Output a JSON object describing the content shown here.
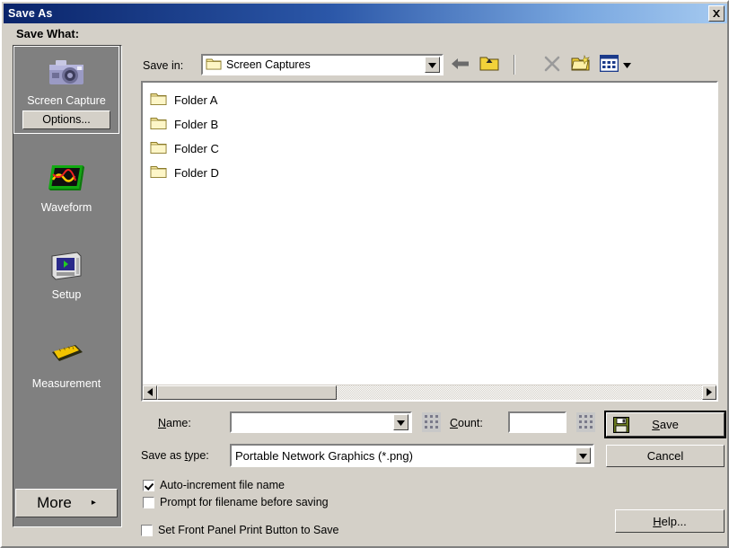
{
  "window": {
    "title": "Save As",
    "close_icon": "close-x-icon",
    "titlebar_color_left": "#0a246a",
    "titlebar_color_right": "#a6caf0",
    "face_color": "#d4d0c8"
  },
  "sidebar": {
    "heading": "Save What:",
    "items": [
      {
        "label": "Screen Capture",
        "icon": "camera-icon",
        "selected": true,
        "options_label": "Options..."
      },
      {
        "label": "Waveform",
        "icon": "waveform-screen-icon",
        "selected": false
      },
      {
        "label": "Setup",
        "icon": "instrument-setup-icon",
        "selected": false
      },
      {
        "label": "Measurement",
        "icon": "ruler-icon",
        "selected": false
      }
    ],
    "more_label": "More",
    "more_arrow": "▸"
  },
  "toolbar": {
    "save_in_label": "Save in:",
    "current_folder": "Screen Captures",
    "folder_icon": "folder-icon",
    "dropdown_icon": "chevron-down-icon",
    "back_label": "Back",
    "back_icon": "back-arrow-icon",
    "up_label": "Up One Level",
    "up_icon": "up-folder-icon",
    "delete_label": "Delete",
    "delete_icon": "delete-x-icon",
    "new_folder_label": "Create New Folder",
    "new_folder_icon": "new-folder-icon",
    "views_label": "Views",
    "views_icon": "views-grid-icon",
    "views_arrow_icon": "chevron-down-icon"
  },
  "file_list": {
    "items": [
      {
        "name": "Folder A",
        "icon": "folder-icon"
      },
      {
        "name": "Folder B",
        "icon": "folder-icon"
      },
      {
        "name": "Folder C",
        "icon": "folder-icon"
      },
      {
        "name": "Folder D",
        "icon": "folder-icon"
      }
    ],
    "scroll_left_icon": "triangle-left-icon",
    "scroll_right_icon": "triangle-right-icon"
  },
  "form": {
    "name_label": "Name:",
    "name_value": "",
    "name_placeholder": "",
    "count_label": "Count:",
    "count_value": "",
    "count_placeholder": "",
    "type_label": "Save as type:",
    "type_value": "Portable Network Graphics (*.png)",
    "keypad_icon": "keypad-grid-icon",
    "dropdown_icon": "chevron-down-icon"
  },
  "checkboxes": [
    {
      "label": "Auto-increment file name",
      "checked": true
    },
    {
      "label": "Prompt for filename before saving",
      "checked": false
    },
    {
      "label": "Set Front Panel Print Button to Save",
      "checked": false
    }
  ],
  "buttons": {
    "save": "Save",
    "save_icon": "floppy-disk-icon",
    "cancel": "Cancel",
    "help": "Help..."
  }
}
